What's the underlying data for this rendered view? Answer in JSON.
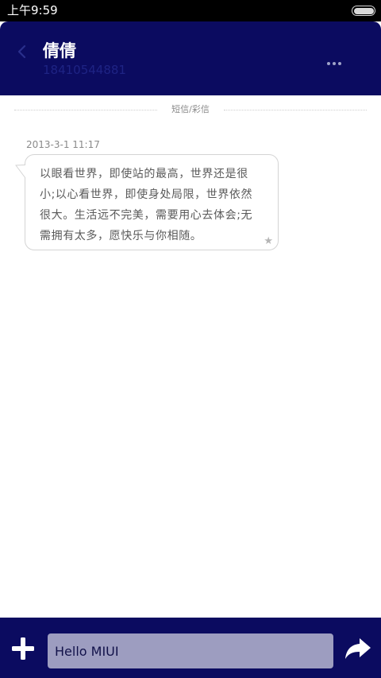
{
  "status_bar": {
    "time": "上午9:59",
    "battery_icon": "battery-icon"
  },
  "header": {
    "contact_name": "倩倩",
    "contact_number": "18410544881",
    "back_icon": "back-icon",
    "more_icon": "more-icon"
  },
  "conversation": {
    "divider_label": "短信/彩信",
    "messages": [
      {
        "timestamp": "2013-3-1 11:17",
        "text": "以眼看世界，即使站的最高，世界还是很小;以心看世界，即使身处局限，世界依然很大。生活远不完美，需要用心去体会;无需拥有太多，愿快乐与你相随。",
        "star_icon": "star-icon"
      }
    ]
  },
  "compose": {
    "input_value": "Hello MIUI",
    "add_icon": "plus-icon",
    "send_icon": "send-icon"
  },
  "colors": {
    "header_bg": "#0b0b60",
    "input_bg": "#9d9dc0",
    "status_bar_bg": "#000000"
  }
}
